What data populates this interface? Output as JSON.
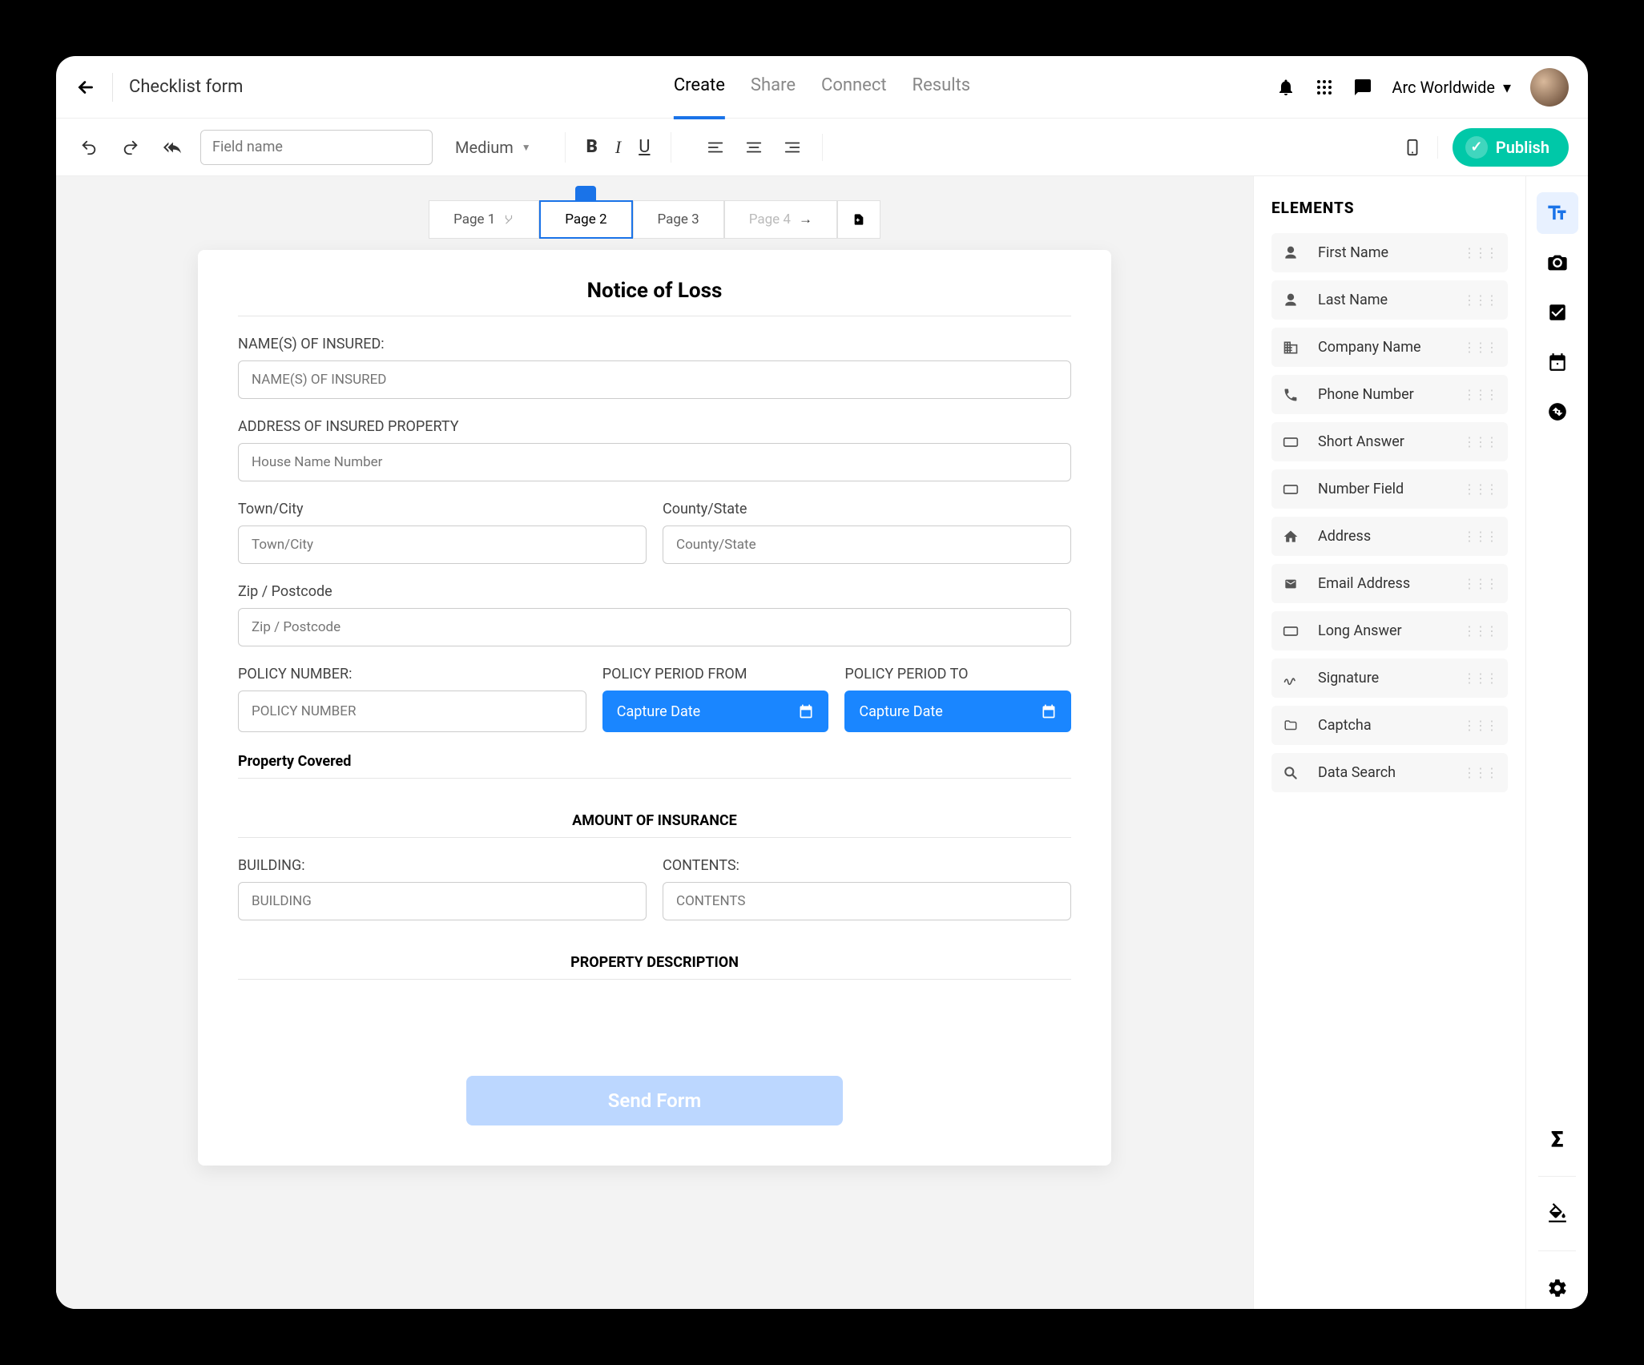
{
  "header": {
    "title": "Checklist form",
    "tabs": [
      "Create",
      "Share",
      "Connect",
      "Results"
    ],
    "active_tab": 0,
    "org_name": "Arc Worldwide"
  },
  "toolbar": {
    "fieldname_placeholder": "Field name",
    "size_label": "Medium",
    "publish_label": "Publish"
  },
  "pages": {
    "items": [
      "Page 1",
      "Page 2",
      "Page 3",
      "Page 4"
    ],
    "active": 1
  },
  "form": {
    "title": "Notice of Loss",
    "labels": {
      "names_insured": "NAME(S) OF INSURED:",
      "address": "ADDRESS OF INSURED PROPERTY",
      "town": "Town/City",
      "county": "County/State",
      "zip": "Zip / Postcode",
      "policy_number": "POLICY NUMBER:",
      "policy_from": "POLICY PERIOD FROM",
      "policy_to": "POLICY PERIOD TO",
      "property_covered": "Property Covered",
      "amount_insurance": "AMOUNT OF INSURANCE",
      "building": "BUILDING:",
      "contents": "CONTENTS:",
      "property_desc": "PROPERTY DESCRIPTION"
    },
    "placeholders": {
      "names_insured": "NAME(S) OF INSURED",
      "house": "House Name Number",
      "town": "Town/City",
      "county": "County/State",
      "zip": "Zip / Postcode",
      "policy_number": "POLICY NUMBER",
      "capture_date": "Capture Date",
      "building": "BUILDING",
      "contents": "CONTENTS"
    },
    "send_label": "Send Form"
  },
  "elements_panel": {
    "title": "ELEMENTS",
    "items": [
      {
        "icon": "person",
        "label": "First Name"
      },
      {
        "icon": "person",
        "label": "Last Name"
      },
      {
        "icon": "business",
        "label": "Company Name"
      },
      {
        "icon": "phone",
        "label": "Phone Number"
      },
      {
        "icon": "short",
        "label": "Short Answer"
      },
      {
        "icon": "short",
        "label": "Number Field"
      },
      {
        "icon": "home",
        "label": "Address"
      },
      {
        "icon": "mail",
        "label": "Email Address"
      },
      {
        "icon": "short",
        "label": "Long Answer"
      },
      {
        "icon": "sign",
        "label": "Signature"
      },
      {
        "icon": "folder",
        "label": "Captcha"
      },
      {
        "icon": "search",
        "label": "Data Search"
      }
    ]
  }
}
